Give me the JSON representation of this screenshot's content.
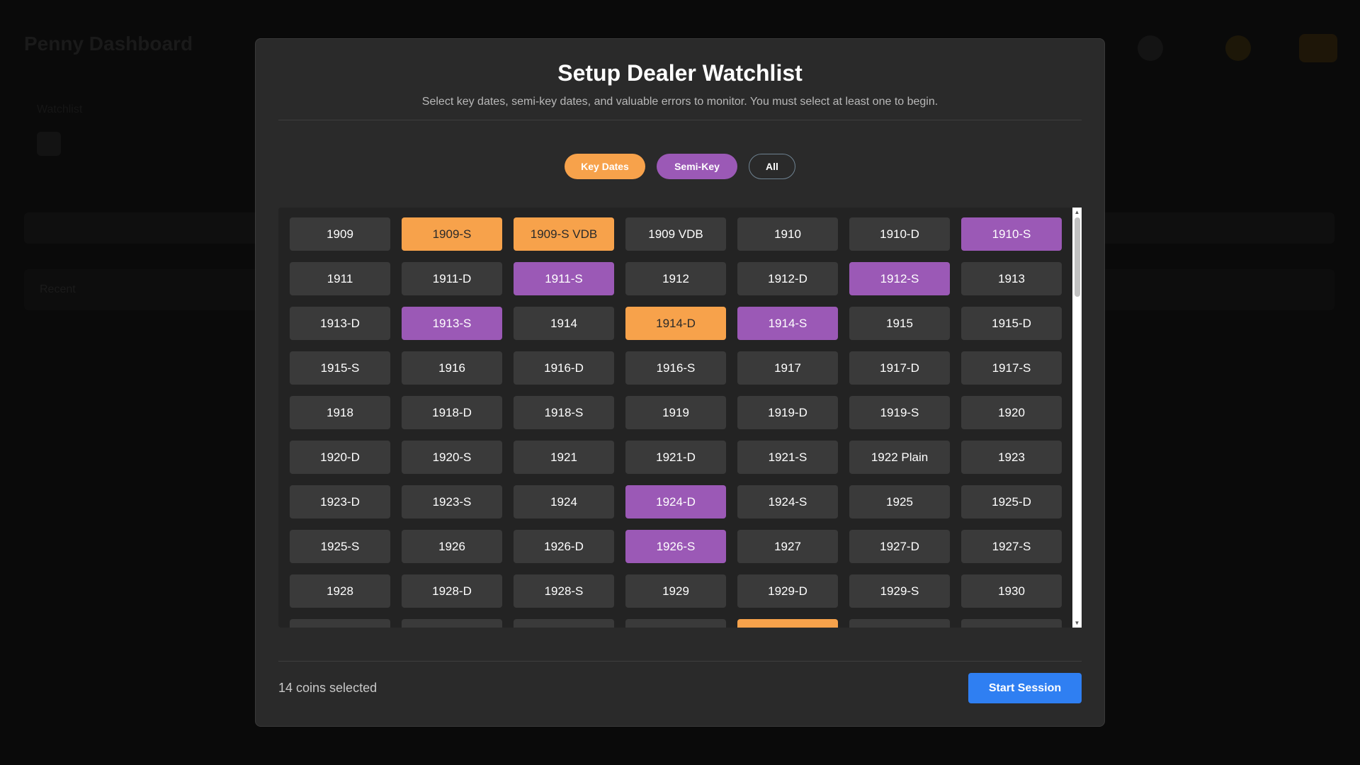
{
  "background": {
    "app_title": "Penny Dashboard",
    "subtitle": "Watchlist",
    "section_label": "Recent"
  },
  "modal": {
    "title": "Setup Dealer Watchlist",
    "subtitle": "Select key dates, semi-key dates, and valuable errors to monitor. You must select at least one to begin."
  },
  "filters": {
    "key_dates": "Key Dates",
    "semi_key": "Semi-Key",
    "all": "All"
  },
  "colors": {
    "key": "#f7a24b",
    "semi": "#9b59b6",
    "normal": "#3a3a3a",
    "primary": "#2f7ff2"
  },
  "coins": [
    {
      "label": "1909",
      "type": "normal"
    },
    {
      "label": "1909-S",
      "type": "key"
    },
    {
      "label": "1909-S VDB",
      "type": "key"
    },
    {
      "label": "1909 VDB",
      "type": "normal"
    },
    {
      "label": "1910",
      "type": "normal"
    },
    {
      "label": "1910-D",
      "type": "normal"
    },
    {
      "label": "1910-S",
      "type": "semi"
    },
    {
      "label": "1911",
      "type": "normal"
    },
    {
      "label": "1911-D",
      "type": "normal"
    },
    {
      "label": "1911-S",
      "type": "semi"
    },
    {
      "label": "1912",
      "type": "normal"
    },
    {
      "label": "1912-D",
      "type": "normal"
    },
    {
      "label": "1912-S",
      "type": "semi"
    },
    {
      "label": "1913",
      "type": "normal"
    },
    {
      "label": "1913-D",
      "type": "normal"
    },
    {
      "label": "1913-S",
      "type": "semi"
    },
    {
      "label": "1914",
      "type": "normal"
    },
    {
      "label": "1914-D",
      "type": "key"
    },
    {
      "label": "1914-S",
      "type": "semi"
    },
    {
      "label": "1915",
      "type": "normal"
    },
    {
      "label": "1915-D",
      "type": "normal"
    },
    {
      "label": "1915-S",
      "type": "normal"
    },
    {
      "label": "1916",
      "type": "normal"
    },
    {
      "label": "1916-D",
      "type": "normal"
    },
    {
      "label": "1916-S",
      "type": "normal"
    },
    {
      "label": "1917",
      "type": "normal"
    },
    {
      "label": "1917-D",
      "type": "normal"
    },
    {
      "label": "1917-S",
      "type": "normal"
    },
    {
      "label": "1918",
      "type": "normal"
    },
    {
      "label": "1918-D",
      "type": "normal"
    },
    {
      "label": "1918-S",
      "type": "normal"
    },
    {
      "label": "1919",
      "type": "normal"
    },
    {
      "label": "1919-D",
      "type": "normal"
    },
    {
      "label": "1919-S",
      "type": "normal"
    },
    {
      "label": "1920",
      "type": "normal"
    },
    {
      "label": "1920-D",
      "type": "normal"
    },
    {
      "label": "1920-S",
      "type": "normal"
    },
    {
      "label": "1921",
      "type": "normal"
    },
    {
      "label": "1921-D",
      "type": "normal"
    },
    {
      "label": "1921-S",
      "type": "normal"
    },
    {
      "label": "1922 Plain",
      "type": "normal"
    },
    {
      "label": "1923",
      "type": "normal"
    },
    {
      "label": "1923-D",
      "type": "normal"
    },
    {
      "label": "1923-S",
      "type": "normal"
    },
    {
      "label": "1924",
      "type": "normal"
    },
    {
      "label": "1924-D",
      "type": "semi"
    },
    {
      "label": "1924-S",
      "type": "normal"
    },
    {
      "label": "1925",
      "type": "normal"
    },
    {
      "label": "1925-D",
      "type": "normal"
    },
    {
      "label": "1925-S",
      "type": "normal"
    },
    {
      "label": "1926",
      "type": "normal"
    },
    {
      "label": "1926-D",
      "type": "normal"
    },
    {
      "label": "1926-S",
      "type": "semi"
    },
    {
      "label": "1927",
      "type": "normal"
    },
    {
      "label": "1927-D",
      "type": "normal"
    },
    {
      "label": "1927-S",
      "type": "normal"
    },
    {
      "label": "1928",
      "type": "normal"
    },
    {
      "label": "1928-D",
      "type": "normal"
    },
    {
      "label": "1928-S",
      "type": "normal"
    },
    {
      "label": "1929",
      "type": "normal"
    },
    {
      "label": "1929-D",
      "type": "normal"
    },
    {
      "label": "1929-S",
      "type": "normal"
    },
    {
      "label": "1930",
      "type": "normal"
    },
    {
      "label": "",
      "type": "normal"
    },
    {
      "label": "",
      "type": "normal"
    },
    {
      "label": "",
      "type": "normal"
    },
    {
      "label": "",
      "type": "normal"
    },
    {
      "label": "",
      "type": "key"
    },
    {
      "label": "",
      "type": "normal"
    },
    {
      "label": "",
      "type": "normal"
    }
  ],
  "footer": {
    "selected_text": "14 coins selected",
    "start_label": "Start Session"
  },
  "scrollbar": {
    "up_icon": "scroll-up-arrow-icon",
    "down_icon": "scroll-down-arrow-icon"
  }
}
